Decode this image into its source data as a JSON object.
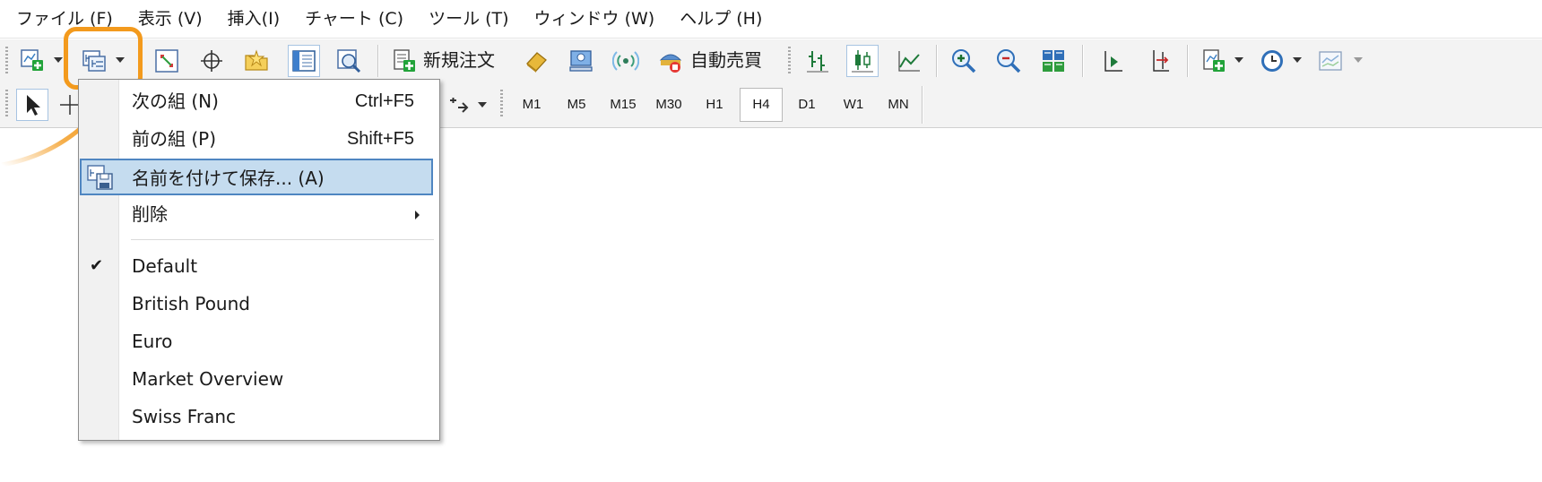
{
  "menubar": {
    "items": [
      {
        "label": "ファイル (F)"
      },
      {
        "label": "表示 (V)"
      },
      {
        "label": "挿入(I)"
      },
      {
        "label": "チャート (C)"
      },
      {
        "label": "ツール (T)"
      },
      {
        "label": "ウィンドウ (W)"
      },
      {
        "label": "ヘルプ (H)"
      }
    ]
  },
  "toolbar": {
    "new_order_label": "新規注文",
    "auto_trading_label": "自動売買"
  },
  "timeframes": {
    "items": [
      "M1",
      "M5",
      "M15",
      "M30",
      "H1",
      "H4",
      "D1",
      "W1",
      "MN"
    ],
    "active": "H4"
  },
  "profiles_menu": {
    "next": {
      "label": "次の組 (N)",
      "shortcut": "Ctrl+F5"
    },
    "prev": {
      "label": "前の組 (P)",
      "shortcut": "Shift+F5"
    },
    "save_as": {
      "label": "名前を付けて保存... (A)"
    },
    "delete": {
      "label": "削除"
    },
    "profiles": [
      "Default",
      "British Pound",
      "Euro",
      "Market Overview",
      "Swiss Franc"
    ],
    "checked_profile": "Default"
  },
  "colors": {
    "highlight_orange": "#f39a1d",
    "menu_selection": "#c5dcef",
    "menu_selection_border": "#4f86c1"
  }
}
